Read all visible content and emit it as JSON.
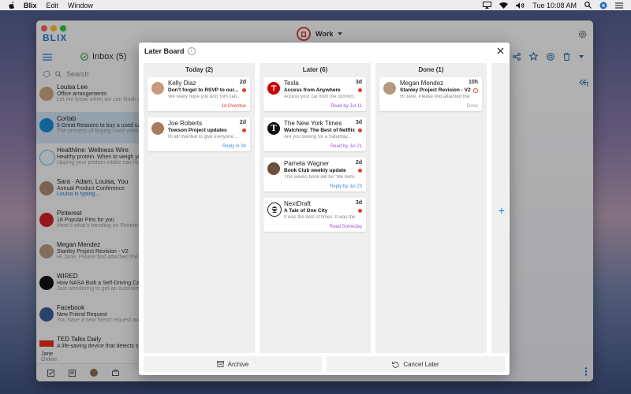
{
  "menubar": {
    "app": "Blix",
    "items": [
      "Edit",
      "Window"
    ],
    "clock": "Tue 10:08 AM"
  },
  "app": {
    "logo": "BLIX",
    "account": "Work",
    "inbox_label": "Inbox (5)",
    "search_placeholder": "Search"
  },
  "mail_list": [
    {
      "from": "Louisa Lee",
      "subject": "Office arrangements",
      "preview": "Let me know when we can finish our"
    },
    {
      "from": "Cortab",
      "subject": "5 Great Reasons to buy a used car onl",
      "preview": "The process of buying used vehicles"
    },
    {
      "from": "Healthline: Wellness Wire",
      "subject": "Healthy protein. When to weigh yourse",
      "preview": "Upping your protein intake can help you"
    },
    {
      "from": "Sara · Adam, Louisa, You",
      "subject": "Annual Product Conference",
      "preview": "Louisa is typing..."
    },
    {
      "from": "Pinterest",
      "subject": "18 Popular Pins for you",
      "preview": "Here's what's trending on Pinterest. Se"
    },
    {
      "from": "Megan Mendez",
      "subject": "Stanley Project Revision - V2",
      "preview": "Hi Jane, Please find attached the late"
    },
    {
      "from": "WIRED",
      "subject": "How NASA Built a Self-Driving Car for",
      "preview": "Just wondering to get an autonomous"
    },
    {
      "from": "Facebook",
      "subject": "New Friend Request",
      "preview": "You have a new friend request awaitin"
    },
    {
      "from": "TED Talks Daily",
      "subject": "A life-saving device that detects silent",
      "preview": ""
    }
  ],
  "footer_user": {
    "name": "Jane",
    "status": "Online"
  },
  "later_board": {
    "title": "Later Board",
    "columns": [
      {
        "title": "Today (2)",
        "cards": [
          {
            "name": "Kelly Diaz",
            "time": "2d",
            "subject": "Don't forget to RSVP to our...",
            "preview": "We really hope you and Tom can...",
            "status": "1d Overdue",
            "status_color": "#d9452b",
            "dot": "solid"
          },
          {
            "name": "Joe Roberts",
            "time": "2d",
            "subject": "Towson Project updates",
            "preview": "Hi all! Wanted to give everyone...",
            "status": "Reply in 3h",
            "status_color": "#3b8fd8",
            "dot": "solid"
          }
        ]
      },
      {
        "title": "Later (6)",
        "cards": [
          {
            "name": "Tesla",
            "time": "3d",
            "subject": "Access from Anywhere",
            "preview": "Access your car from the comfort...",
            "status": "Read by Jul 11",
            "status_color": "#9b59d0",
            "dot": "solid"
          },
          {
            "name": "The New York Times",
            "time": "3d",
            "subject": "Watching: The Best of Netflix...",
            "preview": "Are you looking for a Saturday...",
            "status": "Read by Jul 21",
            "status_color": "#9b59d0",
            "dot": "solid"
          },
          {
            "name": "Pamela Wagner",
            "time": "2d",
            "subject": "Book Club weekly update",
            "preview": "This weeks book will be \"Me Befo...",
            "status": "Reply by Jul 23",
            "status_color": "#3b8fd8",
            "dot": "solid"
          },
          {
            "name": "NextDraft",
            "time": "3d",
            "subject": "A Tale of One City",
            "preview": "It was the best of times. It was the...",
            "status": "Read Someday",
            "status_color": "#9b59d0",
            "dot": "solid"
          }
        ]
      },
      {
        "title": "Done (1)",
        "cards": [
          {
            "name": "Megan Mendez",
            "time": "10h",
            "subject": "Stanley Project Revision - V2",
            "preview": "Hi Jane, Please find attached the...",
            "status": "Done",
            "status_color": "#999999",
            "dot": "ring"
          }
        ]
      }
    ],
    "archive_label": "Archive",
    "cancel_label": "Cancel Later"
  }
}
